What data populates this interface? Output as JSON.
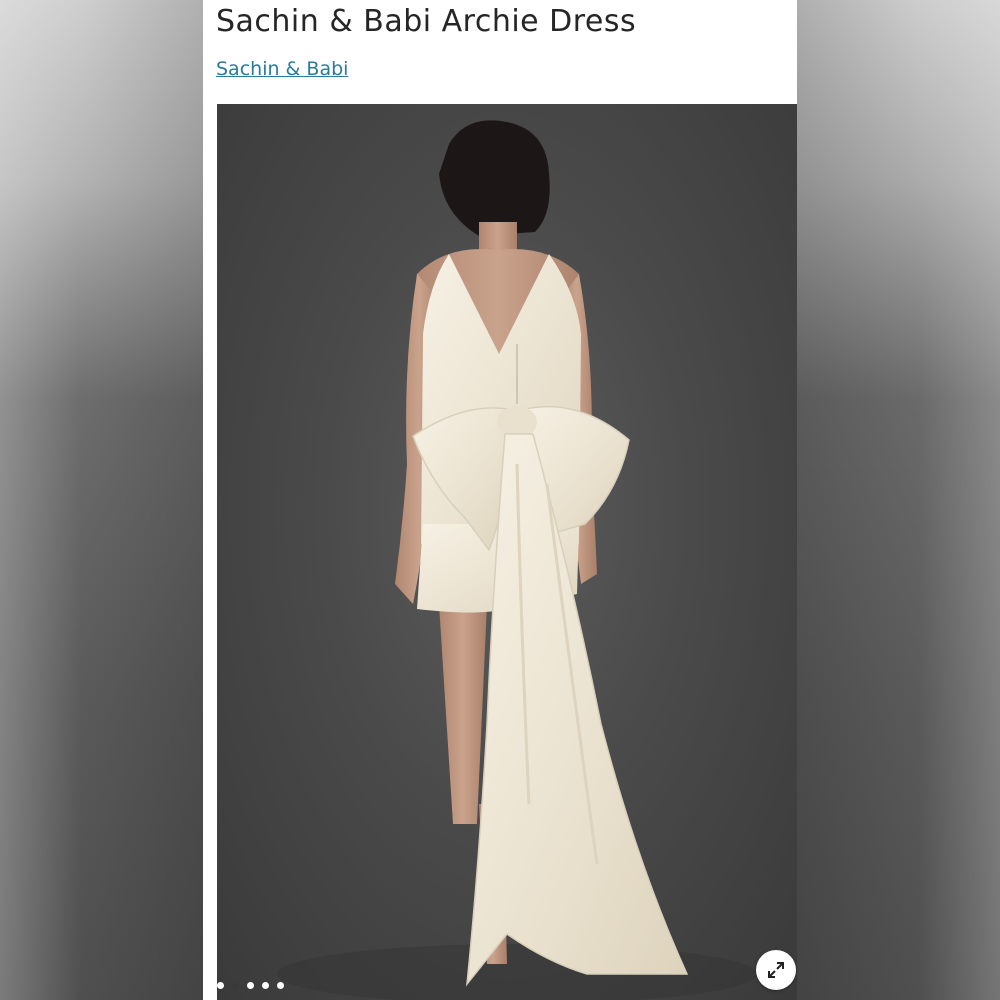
{
  "product": {
    "title": "Sachin & Babi Archie Dress",
    "brand": "Sachin & Babi"
  },
  "gallery": {
    "image_description_icon": "product-photo",
    "image_count": 5,
    "current_index": 2,
    "expand_icon": "expand-arrows-icon"
  },
  "colors": {
    "title_text": "#262626",
    "link": "#2b7a9b",
    "photo_background": "#4a4a4a",
    "dress": "#f1ebdc"
  }
}
